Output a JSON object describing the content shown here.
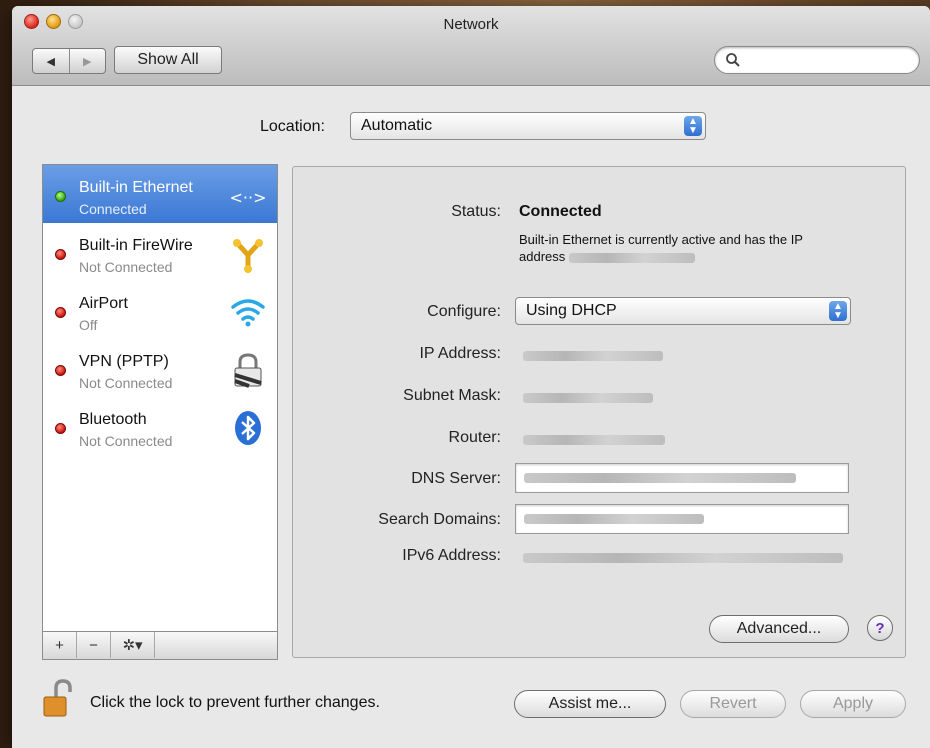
{
  "window": {
    "title": "Network"
  },
  "toolbar": {
    "back_glyph": "◀",
    "forward_glyph": "▶",
    "show_all_label": "Show All",
    "search_placeholder": ""
  },
  "location": {
    "label": "Location:",
    "value": "Automatic"
  },
  "services": [
    {
      "name": "Built-in Ethernet",
      "status": "Connected",
      "state": "connected",
      "icon": "ethernet-icon",
      "selected": true
    },
    {
      "name": "Built-in FireWire",
      "status": "Not Connected",
      "state": "not-connected",
      "icon": "firewire-icon",
      "selected": false
    },
    {
      "name": "AirPort",
      "status": "Off",
      "state": "not-connected",
      "icon": "airport-wifi-icon",
      "selected": false
    },
    {
      "name": "VPN (PPTP)",
      "status": "Not Connected",
      "state": "not-connected",
      "icon": "vpn-lock-icon",
      "selected": false
    },
    {
      "name": "Bluetooth",
      "status": "Not Connected",
      "state": "not-connected",
      "icon": "bluetooth-icon",
      "selected": false
    }
  ],
  "service_toolbar": {
    "add": "+",
    "remove": "−",
    "action": "✲▾"
  },
  "detail": {
    "status_label": "Status:",
    "status_value": "Connected",
    "status_description": "Built-in Ethernet is currently active and has the IP address",
    "configure_label": "Configure:",
    "configure_value": "Using DHCP",
    "ip_label": "IP Address:",
    "subnet_label": "Subnet Mask:",
    "router_label": "Router:",
    "dns_label": "DNS Server:",
    "search_domains_label": "Search Domains:",
    "ipv6_label": "IPv6 Address:",
    "advanced_label": "Advanced...",
    "help_label": "?"
  },
  "footer": {
    "lock_text": "Click the lock to prevent further changes.",
    "assist_label": "Assist me...",
    "revert_label": "Revert",
    "apply_label": "Apply"
  },
  "colors": {
    "selection": "#3b78d4",
    "status_connected": "#34a70c",
    "status_off": "#c8140c",
    "help_mark": "#6a2fb0"
  }
}
